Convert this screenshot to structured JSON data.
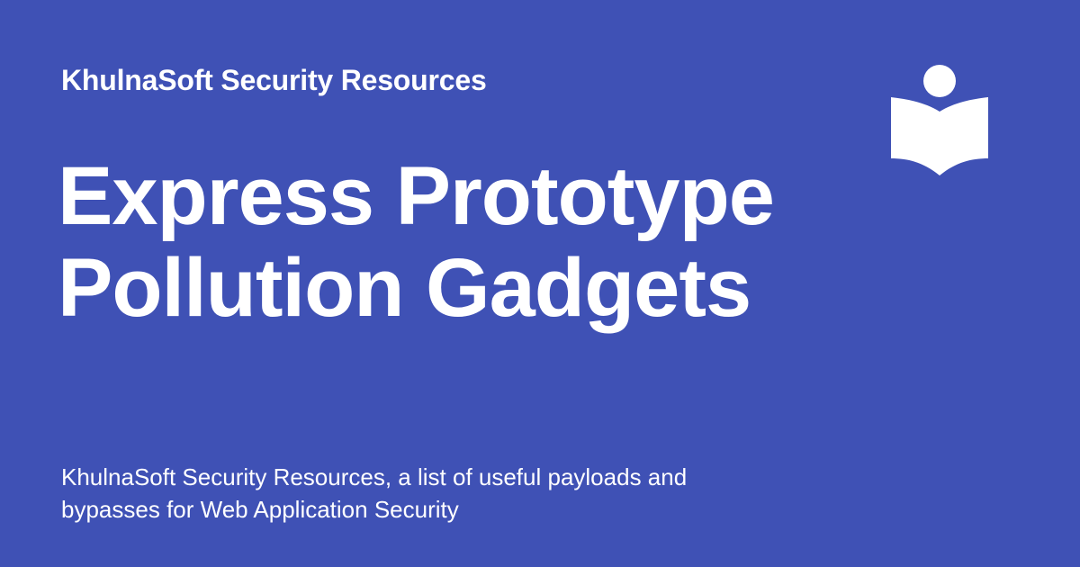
{
  "header": {
    "site_name": "KhulnaSoft Security Resources"
  },
  "main": {
    "title_lines": [
      "Express Prototype",
      "Pollution Gadgets"
    ]
  },
  "footer": {
    "description": "KhulnaSoft Security Resources, a list of useful payloads and bypasses for Web Application Security"
  },
  "logo": {
    "icon": "book-reader-icon"
  },
  "colors": {
    "background": "#3f51b5",
    "text": "#ffffff"
  }
}
